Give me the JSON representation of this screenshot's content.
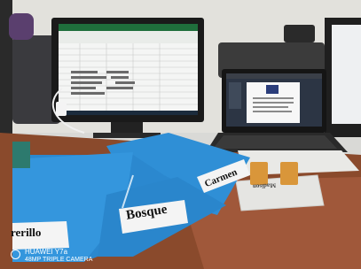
{
  "photo": {
    "folder_labels": {
      "left": "rerillo",
      "center": "Bosque",
      "right": "Carmen",
      "card": "Madison"
    },
    "watermark": {
      "line1": "HUAWEI Y7a",
      "line2": "48MP TRIPLE CAMERA"
    },
    "colors": {
      "wall": "#d9d9d6",
      "desk": "#8a4a2c",
      "folder_blue": "#2f8fd6",
      "monitor_bezel": "#1a1a1a",
      "sticky_note": "#d9963a"
    }
  }
}
